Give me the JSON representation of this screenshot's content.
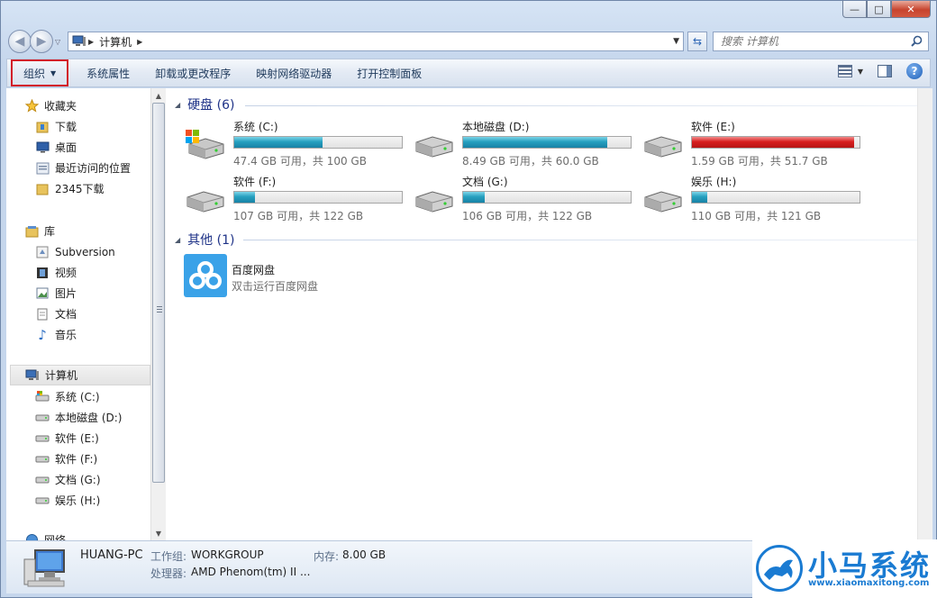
{
  "window": {
    "caption": {
      "minimize": "—",
      "maximize": "□",
      "close": "✕"
    }
  },
  "address": {
    "crumb": "计算机",
    "search_placeholder": "搜索 计算机"
  },
  "toolbar": {
    "organize": "组织",
    "system_properties": "系统属性",
    "uninstall": "卸载或更改程序",
    "map_drive": "映射网络驱动器",
    "control_panel": "打开控制面板",
    "help": "?"
  },
  "nav": {
    "favorites": "收藏夹",
    "favorites_items": [
      "下载",
      "桌面",
      "最近访问的位置",
      "2345下载"
    ],
    "libraries": "库",
    "library_items": [
      "Subversion",
      "视频",
      "图片",
      "文档",
      "音乐"
    ],
    "computer": "计算机",
    "computer_items": [
      "系统 (C:)",
      "本地磁盘 (D:)",
      "软件 (E:)",
      "软件 (F:)",
      "文档 (G:)",
      "娱乐 (H:)"
    ],
    "network": "网络"
  },
  "content": {
    "hard_disks_header": "硬盘 (6)",
    "drives": [
      {
        "name": "系统 (C:)",
        "info": "47.4 GB 可用，共 100 GB",
        "used_fraction": 0.526,
        "status": "normal"
      },
      {
        "name": "本地磁盘 (D:)",
        "info": "8.49 GB 可用，共 60.0 GB",
        "used_fraction": 0.858,
        "status": "normal"
      },
      {
        "name": "软件 (E:)",
        "info": "1.59 GB 可用，共 51.7 GB",
        "used_fraction": 0.969,
        "status": "low"
      },
      {
        "name": "软件 (F:)",
        "info": "107 GB 可用，共 122 GB",
        "used_fraction": 0.123,
        "status": "normal"
      },
      {
        "name": "文档 (G:)",
        "info": "106 GB 可用，共 122 GB",
        "used_fraction": 0.131,
        "status": "normal"
      },
      {
        "name": "娱乐 (H:)",
        "info": "110 GB 可用，共 121 GB",
        "used_fraction": 0.091,
        "status": "normal"
      }
    ],
    "other_header": "其他 (1)",
    "other_item": {
      "name": "百度网盘",
      "desc": "双击运行百度网盘"
    }
  },
  "details": {
    "pc_name": "HUANG-PC",
    "workgroup_label": "工作组:",
    "workgroup_value": "WORKGROUP",
    "memory_label": "内存:",
    "memory_value": "8.00 GB",
    "cpu_label": "处理器:",
    "cpu_value": "AMD Phenom(tm) II ..."
  },
  "watermark": {
    "brand": "小马系统",
    "url": "www.xiaomaxitong.com"
  },
  "colors": {
    "accent": "#1a7bd2",
    "bar_normal": "#26a0bf",
    "bar_low": "#d81f1f",
    "organize_highlight": "#d21f2a"
  }
}
